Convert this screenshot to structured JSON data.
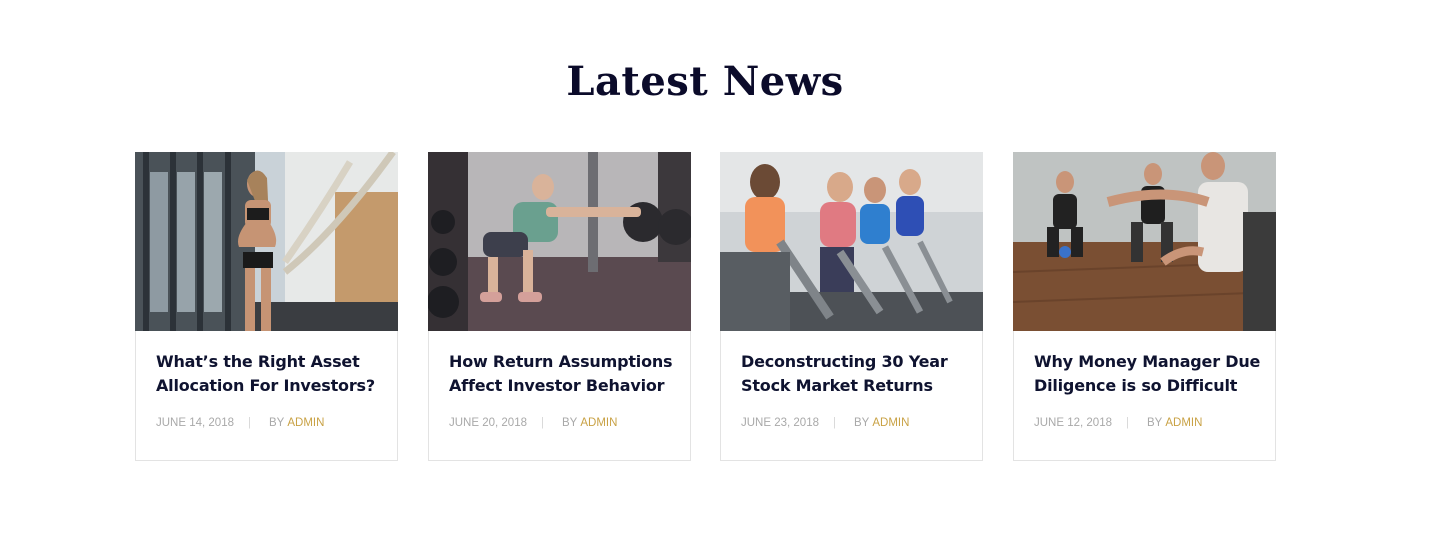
{
  "section": {
    "title": "Latest News"
  },
  "posts": [
    {
      "title": "What’s the Right Asset Allocation For Investors?",
      "date": "JUNE 14, 2018",
      "by": "BY",
      "author": "ADMIN",
      "image": "battle-ropes-woman"
    },
    {
      "title": "How Return Assumptions Affect Investor Behavior",
      "date": "JUNE 20, 2018",
      "by": "BY",
      "author": "ADMIN",
      "image": "senior-man-squat-gym"
    },
    {
      "title": "Deconstructing 30 Year Stock Market Returns",
      "date": "JUNE 23, 2018",
      "by": "BY",
      "author": "ADMIN",
      "image": "spin-class-cycling"
    },
    {
      "title": "Why Money Manager Due Diligence is so Difficult",
      "date": "JUNE 12, 2018",
      "by": "BY",
      "author": "ADMIN",
      "image": "kettlebell-group-class"
    }
  ],
  "colors": {
    "title": "#0b0b2a",
    "heading": "#0f1330",
    "meta": "#a9a9a9",
    "author": "#c9a245",
    "border": "#e3e3e3"
  }
}
